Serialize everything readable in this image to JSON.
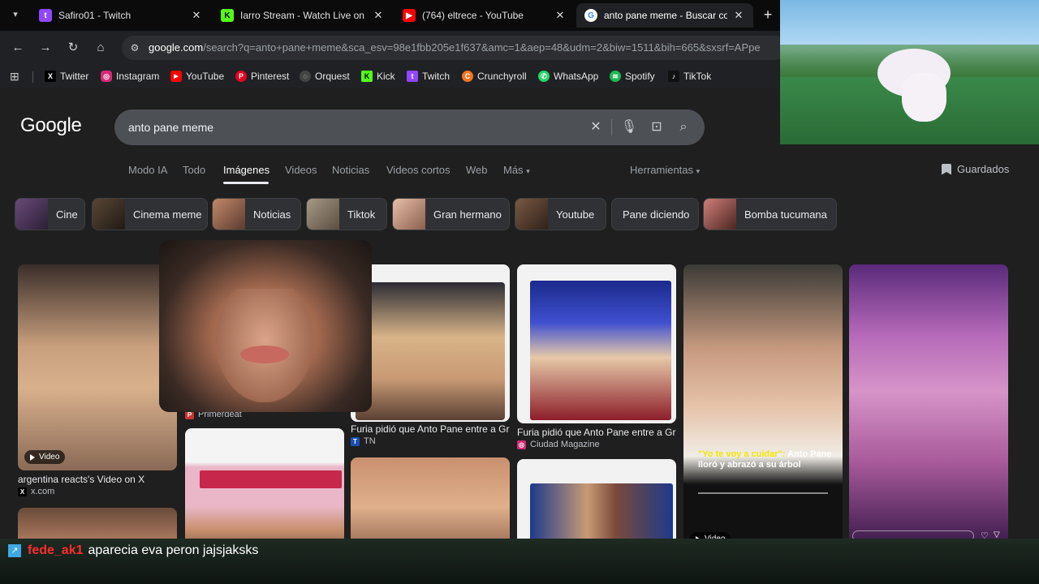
{
  "tabs": [
    {
      "label": "Safiro01 - Twitch",
      "favicon_color": "#9146ff",
      "active": false
    },
    {
      "label": "Iarro Stream - Watch Live on Ki",
      "favicon_color": "#53fc18",
      "active": false
    },
    {
      "label": "(764) eltrece - YouTube",
      "favicon_color": "#ff0000",
      "active": false
    },
    {
      "label": "anto pane meme - Buscar con G",
      "favicon_color": "#4285f4",
      "active": true
    }
  ],
  "address": {
    "domain": "google.com",
    "path": "/search?q=anto+pane+meme&sca_esv=98e1fbb205e1f637&amc=1&aep=48&udm=2&biw=1511&bih=665&sxsrf=APpe"
  },
  "bookmarks": [
    {
      "label": "Twitter",
      "color": "#000000",
      "glyph": "X"
    },
    {
      "label": "Instagram",
      "color": "#d62976",
      "glyph": "◎"
    },
    {
      "label": "YouTube",
      "color": "#ff0000",
      "glyph": "▶"
    },
    {
      "label": "Pinterest",
      "color": "#e60023",
      "glyph": "P"
    },
    {
      "label": "Orquest",
      "color": "#444444",
      "glyph": "◌"
    },
    {
      "label": "Kick",
      "color": "#53fc18",
      "glyph": "K"
    },
    {
      "label": "Twitch",
      "color": "#9146ff",
      "glyph": "t"
    },
    {
      "label": "Crunchyroll",
      "color": "#f47521",
      "glyph": "C"
    },
    {
      "label": "WhatsApp",
      "color": "#25d366",
      "glyph": "✆"
    },
    {
      "label": "Spotify",
      "color": "#1db954",
      "glyph": "≋"
    },
    {
      "label": "TikTok",
      "color": "#111111",
      "glyph": "♪"
    }
  ],
  "google": {
    "logo": "Google",
    "query": "anto pane meme",
    "nav_tabs": [
      "Modo IA",
      "Todo",
      "Imágenes",
      "Videos",
      "Noticias",
      "Videos cortos",
      "Web",
      "Más"
    ],
    "active_tab": "Imágenes",
    "tools": "Herramientas",
    "saved": "Guardados",
    "chips": [
      {
        "label": "Cine",
        "thumb": "#6a4a78"
      },
      {
        "label": "Cinema meme",
        "thumb": "#5a4636"
      },
      {
        "label": "Noticias",
        "thumb": "#9b6b4e"
      },
      {
        "label": "Tiktok",
        "thumb": "#8a7b6b"
      },
      {
        "label": "Gran hermano",
        "thumb": "#c89c86"
      },
      {
        "label": "Youtube",
        "thumb": "#7a5a44"
      },
      {
        "label": "Pane diciendo",
        "thumb": ""
      },
      {
        "label": "Bomba tucumana",
        "thumb": "#b36a5a"
      }
    ],
    "results": [
      {
        "caption": "argentina reacts's Video on X",
        "source": "x.com",
        "badge": "Video"
      },
      {
        "caption": "",
        "source": "Primerdeat",
        "badge": ""
      },
      {
        "caption": "Furia pidió que Anto Pane entre a Gra...",
        "source": "TN",
        "badge": ""
      },
      {
        "caption": "Furia pidió que Anto Pane entre a Gra...",
        "source": "Ciudad Magazine",
        "badge": ""
      },
      {
        "caption": "",
        "source": "",
        "badge": "Video",
        "overlay_highlight": "\"Yo te voy a cuidar\":",
        "overlay_text": "Anto Pane lloró y abrazó a su árbol"
      },
      {
        "caption": "",
        "source": "",
        "badge": ""
      }
    ]
  },
  "chat": {
    "username": "fede_ak1",
    "message": "aparecia eva peron jajsjaksks"
  }
}
